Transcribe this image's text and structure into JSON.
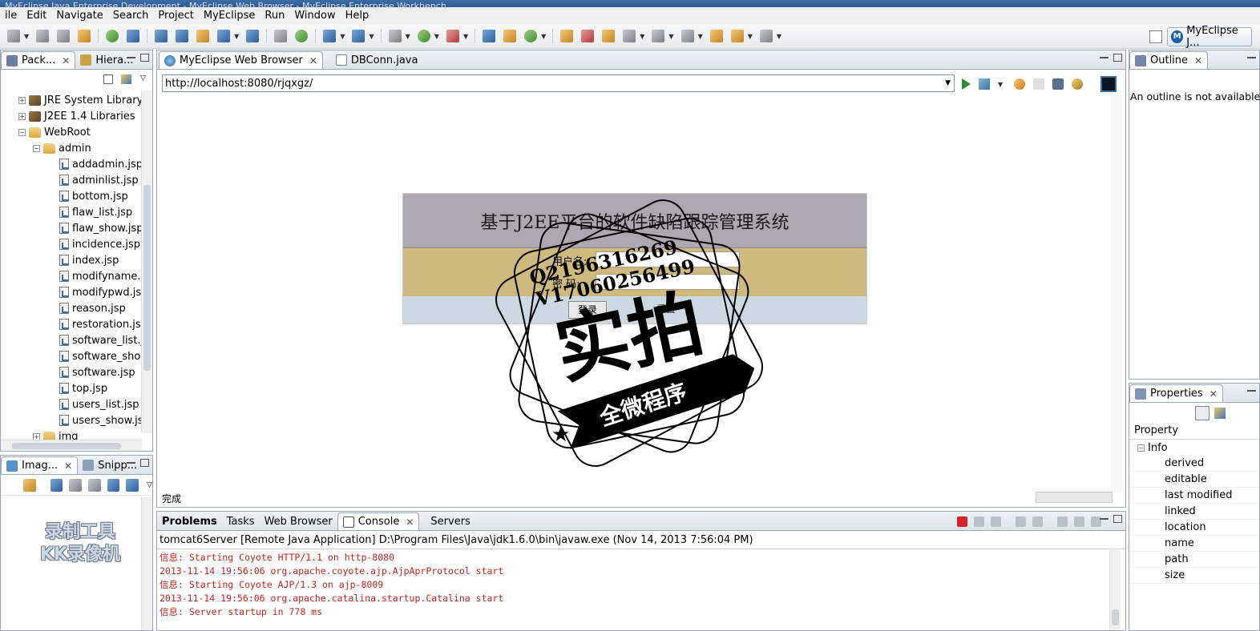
{
  "window": {
    "title": "MyEclipse Java Enterprise Development - MyEclipse Web Browser - MyEclipse Enterprise Workbench"
  },
  "menu": [
    "ile",
    "Edit",
    "Navigate",
    "Search",
    "Project",
    "MyEclipse",
    "Run",
    "Window",
    "Help"
  ],
  "perspective": {
    "label": "MyEclipse J..."
  },
  "package_explorer": {
    "tabs": [
      {
        "label": "Pack..."
      },
      {
        "label": "Hiera..."
      }
    ],
    "tree": [
      {
        "label": "JRE System Library",
        "kind": "lib",
        "indent": 0,
        "expand": "+"
      },
      {
        "label": "J2EE 1.4 Libraries",
        "kind": "lib",
        "indent": 0,
        "expand": "+"
      },
      {
        "label": "WebRoot",
        "kind": "folder",
        "indent": 0,
        "expand": "-"
      },
      {
        "label": "admin",
        "kind": "folder",
        "indent": 1,
        "expand": "-"
      },
      {
        "label": "addadmin.jsp",
        "kind": "jsp",
        "indent": 2
      },
      {
        "label": "adminlist.jsp",
        "kind": "jsp",
        "indent": 2
      },
      {
        "label": "bottom.jsp",
        "kind": "jsp",
        "indent": 2
      },
      {
        "label": "flaw_list.jsp",
        "kind": "jsp",
        "indent": 2
      },
      {
        "label": "flaw_show.jsp",
        "kind": "jsp",
        "indent": 2
      },
      {
        "label": "incidence.jsp",
        "kind": "jsp",
        "indent": 2
      },
      {
        "label": "index.jsp",
        "kind": "jsp",
        "indent": 2
      },
      {
        "label": "modifyname.",
        "kind": "jsp",
        "indent": 2
      },
      {
        "label": "modifypwd.js",
        "kind": "jsp",
        "indent": 2
      },
      {
        "label": "reason.jsp",
        "kind": "jsp",
        "indent": 2
      },
      {
        "label": "restoration.js",
        "kind": "jsp",
        "indent": 2
      },
      {
        "label": "software_list.j",
        "kind": "jsp",
        "indent": 2
      },
      {
        "label": "software_sho",
        "kind": "jsp",
        "indent": 2
      },
      {
        "label": "software.jsp",
        "kind": "jsp",
        "indent": 2
      },
      {
        "label": "top.jsp",
        "kind": "jsp",
        "indent": 2
      },
      {
        "label": "users_list.jsp",
        "kind": "jsp",
        "indent": 2
      },
      {
        "label": "users_show.js",
        "kind": "jsp",
        "indent": 2
      },
      {
        "label": "img",
        "kind": "folder",
        "indent": 1,
        "expand": "+"
      }
    ]
  },
  "image_panel": {
    "tabs": [
      {
        "label": "Imag..."
      },
      {
        "label": "Snipp..."
      }
    ],
    "watermark": [
      "录制工具",
      "KK录像机"
    ]
  },
  "editor": {
    "tabs": [
      {
        "label": "MyEclipse Web Browser"
      },
      {
        "label": "DBConn.java"
      }
    ],
    "url": "http://localhost:8080/rjqxgz/",
    "status": "完成",
    "page": {
      "title": "基于J2EE平台的软件缺陷跟踪管理系统",
      "username_label": "用户名:",
      "password_label": "密 码:",
      "login_button": "登录",
      "reset_button": "重置"
    },
    "stamp": {
      "qq": "Q2196316269",
      "vx": "V17060256499",
      "main": "实拍",
      "ribbon": "全微程序"
    }
  },
  "console": {
    "tabs": [
      {
        "label": "Problems"
      },
      {
        "label": "Tasks"
      },
      {
        "label": "Web Browser"
      },
      {
        "label": "Console"
      },
      {
        "label": "Servers"
      }
    ],
    "header": "tomcat6Server [Remote Java Application] D:\\Program Files\\Java\\jdk1.6.0\\bin\\javaw.exe (Nov 14, 2013 7:56:04 PM)",
    "lines": [
      "信息: Starting Coyote HTTP/1.1 on http-8080",
      "2013-11-14 19:56:06 org.apache.coyote.ajp.AjpAprProtocol start",
      "信息: Starting Coyote AJP/1.3 on ajp-8009",
      "2013-11-14 19:56:06 org.apache.catalina.startup.Catalina start",
      "信息: Server startup in 778 ms"
    ]
  },
  "outline": {
    "tab": "Outline",
    "message": "An outline is not available."
  },
  "properties": {
    "tab": "Properties",
    "column": "Property",
    "category": "Info",
    "rows": [
      "derived",
      "editable",
      "last modified",
      "linked",
      "location",
      "name",
      "path",
      "size"
    ]
  }
}
